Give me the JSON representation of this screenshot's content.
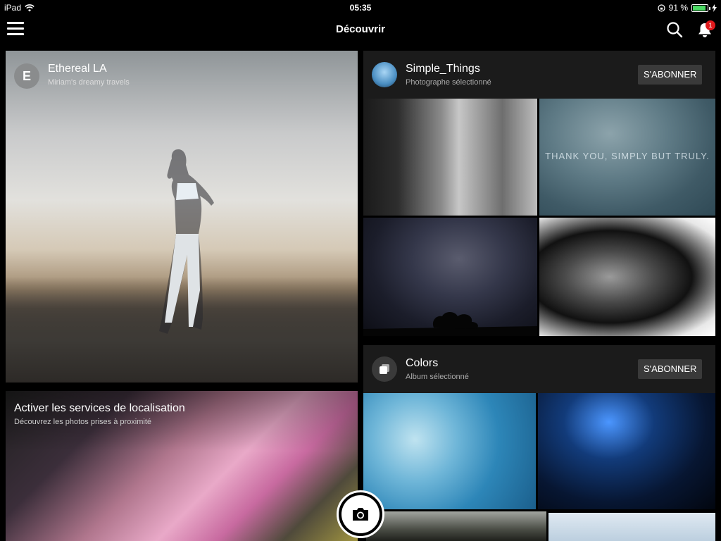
{
  "status": {
    "device": "iPad",
    "time": "05:35",
    "battery": "91 %",
    "battery_level": 0.91
  },
  "nav": {
    "title": "Découvrir",
    "notification_count": "1"
  },
  "cards": {
    "ethereal": {
      "avatar_letter": "E",
      "title": "Ethereal LA",
      "subtitle": "Miriam's dreamy travels"
    },
    "location": {
      "title": "Activer les services de localisation",
      "subtitle": "Découvrez les photos prises à proximité"
    },
    "simple": {
      "title": "Simple_Things",
      "subtitle": "Photographe sélectionné",
      "subscribe": "S'ABONNER",
      "photo_caption": "THANK YOU, SIMPLY BUT TRULY."
    },
    "colors": {
      "title": "Colors",
      "subtitle": "Album sélectionné",
      "subscribe": "S'ABONNER"
    }
  },
  "icons": {
    "menu": "menu-icon",
    "search": "search-icon",
    "bell": "bell-icon",
    "camera": "camera-icon",
    "wifi": "wifi-icon",
    "lock": "rotation-lock-icon",
    "charging": "charging-icon",
    "album": "album-icon"
  },
  "colors": {
    "badge": "#e0191c",
    "battery": "#4cd964",
    "card_header": "#1b1b1b",
    "button": "#3a3a3a"
  }
}
